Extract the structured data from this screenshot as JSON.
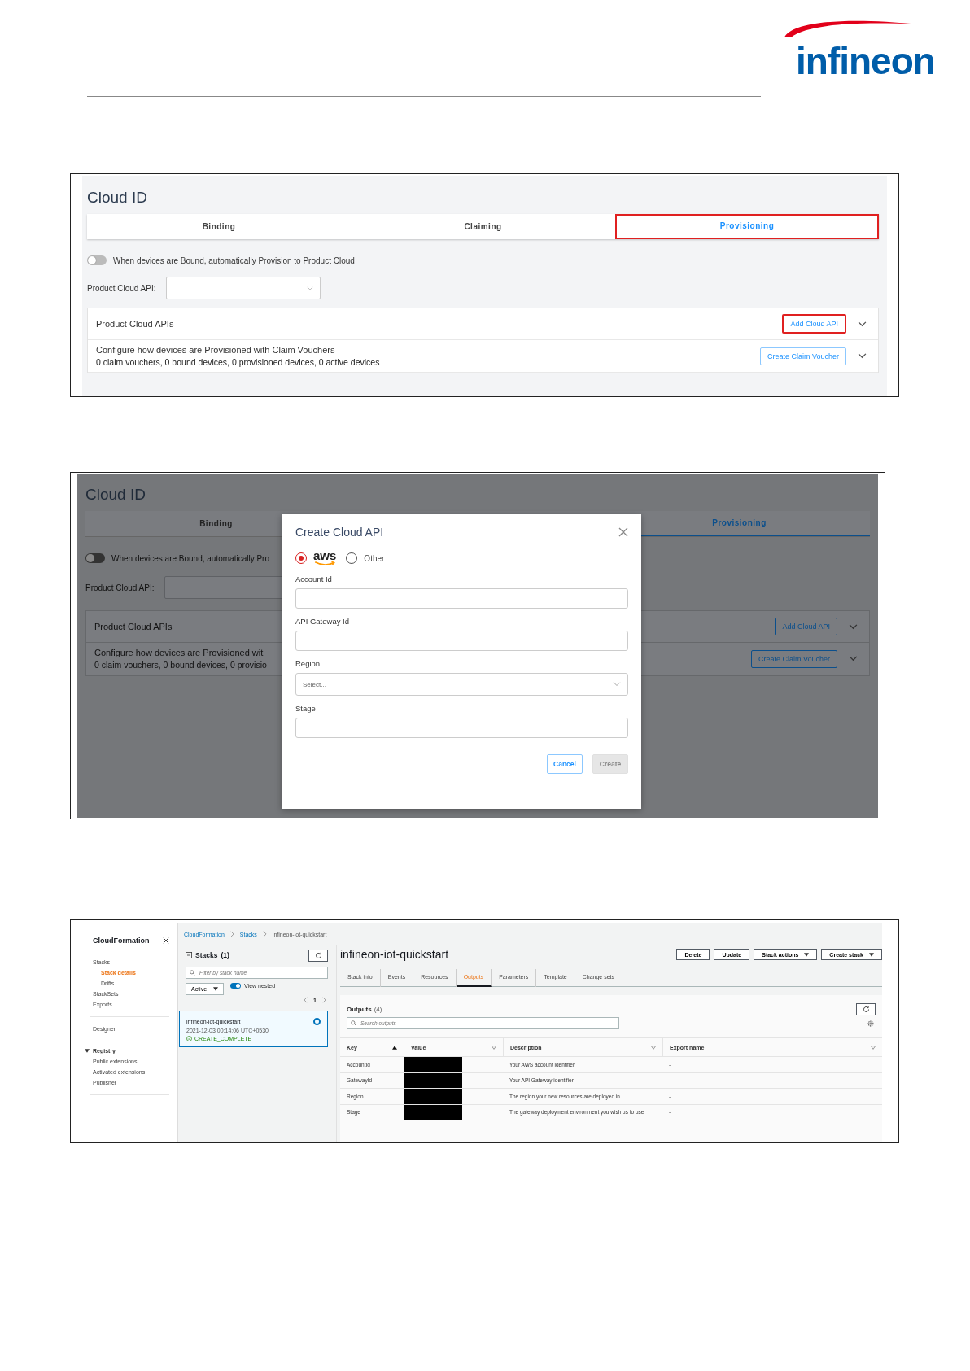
{
  "logo": {
    "text": "infineon"
  },
  "cloud_id_page": {
    "title": "Cloud ID",
    "tabs": [
      {
        "label": "Binding",
        "selected": false,
        "highlighted": false
      },
      {
        "label": "Claiming",
        "selected": false,
        "highlighted": false
      },
      {
        "label": "Provisioning",
        "selected": true,
        "highlighted": true
      }
    ],
    "auto_provision": {
      "label": "When devices are Bound, automatically Provision to Product Cloud",
      "on": false
    },
    "product_cloud_api": {
      "label": "Product Cloud API:"
    },
    "sections": [
      {
        "title": "Product Cloud APIs",
        "button": {
          "label": "Add Cloud API",
          "highlighted": true
        }
      },
      {
        "title": "Configure how devices are Provisioned with Claim Vouchers",
        "summary": "0 claim vouchers, 0 bound devices, 0 provisioned devices, 0 active devices",
        "button": {
          "label": "Create Claim Voucher",
          "highlighted": false
        }
      }
    ]
  },
  "dialog_view": {
    "background": {
      "title": "Cloud ID",
      "tabs": [
        {
          "label": "Binding",
          "selected": false
        },
        {
          "label": "Provisioning",
          "selected": true
        }
      ],
      "auto_provision": {
        "label": "When devices are Bound, automatically Pro",
        "on": false
      },
      "product_cloud_api": {
        "label": "Product Cloud API:"
      },
      "sections": [
        {
          "title": "Product Cloud APIs",
          "button": "Add Cloud API"
        },
        {
          "title": "Configure how devices are Provisioned wit",
          "summary": "0 claim vouchers, 0 bound devices, 0 provisio",
          "button": "Create Claim Voucher"
        }
      ]
    },
    "dialog": {
      "title": "Create Cloud API",
      "providers": [
        {
          "kind": "logo",
          "label": "aws",
          "selected": true
        },
        {
          "kind": "text",
          "label": "Other",
          "selected": false
        }
      ],
      "fields": [
        {
          "label": "Account Id",
          "kind": "text"
        },
        {
          "label": "API Gateway Id",
          "kind": "text"
        },
        {
          "label": "Region",
          "kind": "select",
          "placeholder": "Select..."
        },
        {
          "label": "Stage",
          "kind": "text"
        }
      ],
      "buttons": [
        {
          "label": "Cancel",
          "disabled": false
        },
        {
          "label": "Create",
          "disabled": true
        }
      ]
    }
  },
  "cloudformation": {
    "nav": {
      "title": "CloudFormation",
      "groups": [
        {
          "items": [
            {
              "label": "Stacks",
              "selected": false,
              "children": [
                {
                  "label": "Stack details",
                  "selected": true
                },
                {
                  "label": "Drifts",
                  "selected": false
                }
              ]
            },
            {
              "label": "StackSets",
              "selected": false
            },
            {
              "label": "Exports",
              "selected": false
            }
          ]
        },
        {
          "items": [
            {
              "label": "Designer",
              "selected": false
            }
          ]
        },
        {
          "heading": {
            "label": "Registry",
            "expanded": true
          },
          "items": [
            {
              "label": "Public extensions",
              "selected": false
            },
            {
              "label": "Activated extensions",
              "selected": false
            },
            {
              "label": "Publisher",
              "selected": false
            }
          ]
        }
      ]
    },
    "breadcrumbs": [
      "CloudFormation",
      "Stacks",
      "infineon-iot-quickstart"
    ],
    "stacks_panel": {
      "title": "Stacks",
      "count": "(1)",
      "search": {
        "placeholder": "Filter by stack name"
      },
      "filter": "Active",
      "view_nested": {
        "label": "View nested",
        "on": true
      },
      "page": "1",
      "stacks": [
        {
          "name": "infineon-iot-quickstart",
          "time": "2021-12-03 00:14:06 UTC+0530",
          "status": "CREATE_COMPLETE",
          "selected": true
        }
      ]
    },
    "stack": {
      "title": "infineon-iot-quickstart",
      "actions": [
        {
          "label": "Delete",
          "dropdown": false
        },
        {
          "label": "Update",
          "dropdown": false
        },
        {
          "label": "Stack actions",
          "dropdown": true
        },
        {
          "label": "Create stack",
          "dropdown": true
        }
      ],
      "tabs": [
        {
          "label": "Stack info",
          "selected": false
        },
        {
          "label": "Events",
          "selected": false
        },
        {
          "label": "Resources",
          "selected": false
        },
        {
          "label": "Outputs",
          "selected": true
        },
        {
          "label": "Parameters",
          "selected": false
        },
        {
          "label": "Template",
          "selected": false
        },
        {
          "label": "Change sets",
          "selected": false
        }
      ],
      "outputs": {
        "title": "Outputs",
        "count": "(4)",
        "search": {
          "placeholder": "Search outputs"
        },
        "columns": [
          {
            "label": "Key",
            "sorted": true
          },
          {
            "label": "Value",
            "sorted": false
          },
          {
            "label": "Description",
            "sorted": false
          },
          {
            "label": "Export name",
            "sorted": false
          }
        ],
        "rows": [
          {
            "key": "AccountId",
            "description": "Your AWS account identifier",
            "export_name": "-"
          },
          {
            "key": "GatewayId",
            "description": "Your API Gateway identifier",
            "export_name": "-"
          },
          {
            "key": "Region",
            "description": "The region your new resources are deployed in",
            "export_name": "-"
          },
          {
            "key": "Stage",
            "description": "The gateway deployment environment you wish us to use",
            "export_name": "-"
          }
        ]
      }
    }
  }
}
